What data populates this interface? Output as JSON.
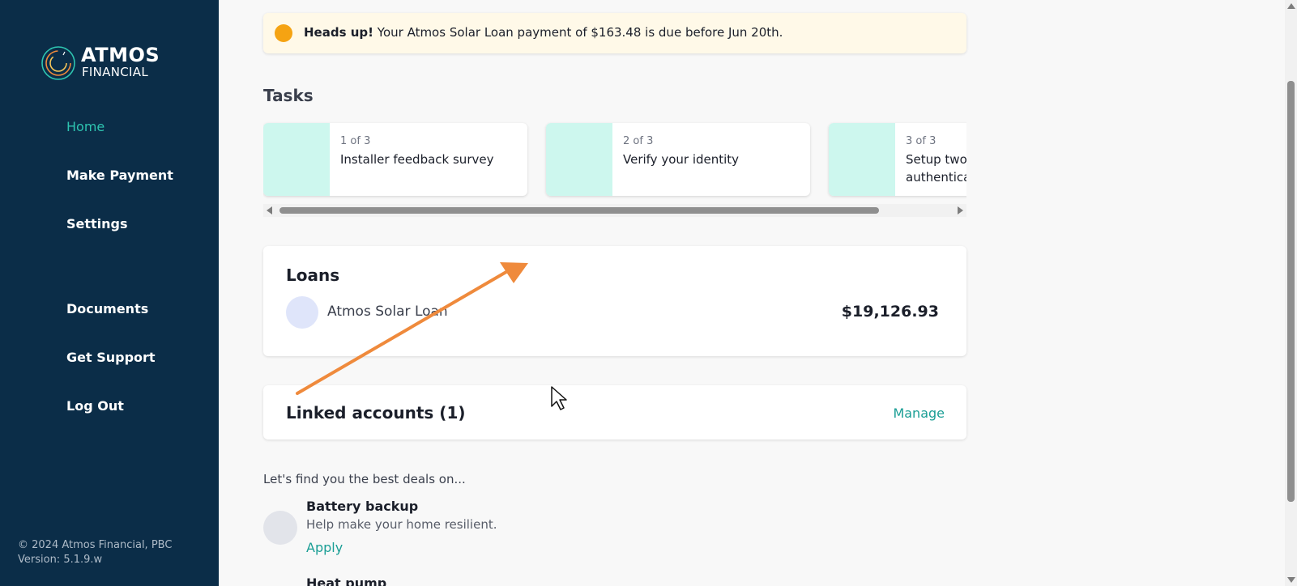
{
  "brand": {
    "name_line1": "ATMOS",
    "name_line2": "FINANCIAL",
    "colors": {
      "sidebar": "#0b2d48",
      "accent": "#2ec4b0",
      "link": "#1a9e95",
      "warning": "#f5a312"
    }
  },
  "sidebar": {
    "items": [
      {
        "label": "Home",
        "active": true
      },
      {
        "label": "Make Payment"
      },
      {
        "label": "Settings"
      },
      {
        "label": "Documents"
      },
      {
        "label": "Get Support"
      },
      {
        "label": "Log Out"
      }
    ],
    "copyright": "© 2024 Atmos Financial, PBC",
    "version": "Version: 5.1.9.w"
  },
  "alert": {
    "lead": "Heads up!",
    "message": "Your Atmos Solar Loan payment of $163.48 is due before Jun 20th.",
    "icon": "warning-dot-icon"
  },
  "tasks": {
    "title": "Tasks",
    "items": [
      {
        "step": "1 of 3",
        "title": "Installer feedback survey"
      },
      {
        "step": "2 of 3",
        "title": "Verify your identity"
      },
      {
        "step": "3 of 3",
        "title": "Setup two-factor authentication"
      }
    ]
  },
  "loans": {
    "title": "Loans",
    "items": [
      {
        "name": "Atmos Solar Loan",
        "amount": "$19,126.93"
      }
    ]
  },
  "linked_accounts": {
    "title": "Linked accounts (1)",
    "manage_label": "Manage"
  },
  "deals": {
    "title": "Let's find you the best deals on...",
    "items": [
      {
        "name": "Battery backup",
        "description": "Help make your home resilient.",
        "action": "Apply"
      },
      {
        "name": "Heat pump"
      }
    ]
  }
}
